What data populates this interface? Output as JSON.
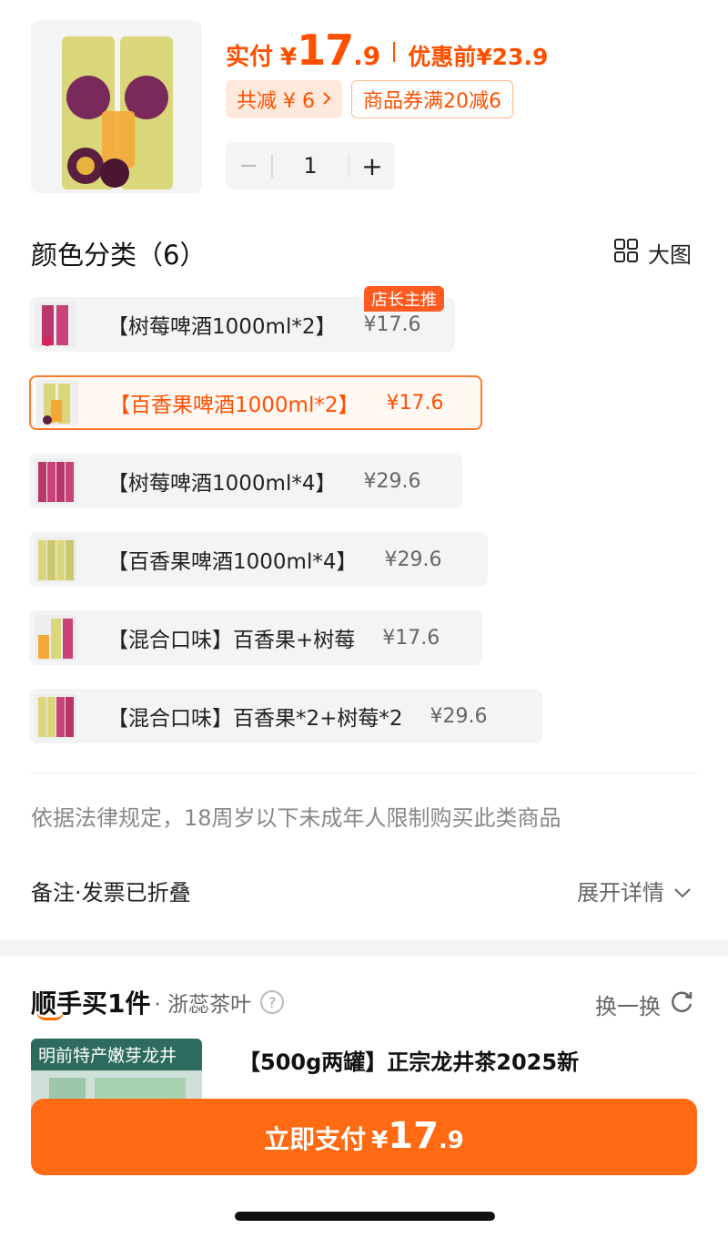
{
  "product": {
    "paid_label": "实付",
    "currency": "¥",
    "price_int": "17",
    "price_dec": ".9",
    "original_label": "优惠前",
    "original_price": "¥23.9",
    "discount_chip": "共减 ¥ 6",
    "coupon_chip": "商品券满20减6"
  },
  "stepper": {
    "minus": "−",
    "quantity": "1",
    "plus": "+"
  },
  "variants": {
    "title": "颜色分类（6）",
    "view_toggle": "大图",
    "recommend_tag": "店长主推",
    "options": [
      {
        "name": "【树莓啤酒1000ml*2】",
        "price": "¥17.6"
      },
      {
        "name": "【百香果啤酒1000ml*2】",
        "price": "¥17.6"
      },
      {
        "name": "【树莓啤酒1000ml*4】",
        "price": "¥29.6"
      },
      {
        "name": "【百香果啤酒1000ml*4】",
        "price": "¥29.6"
      },
      {
        "name": "【混合口味】百香果+树莓",
        "price": "¥17.6"
      },
      {
        "name": "【混合口味】百香果*2+树莓*2",
        "price": "¥29.6"
      }
    ]
  },
  "notice": "依据法律规定，18周岁以下未成年人限制购买此类商品",
  "remark": {
    "label": "备注·发票已折叠",
    "expand": "展开详情"
  },
  "add_on": {
    "title": "顺手买1件",
    "store": "· 浙蕊茶叶",
    "swap": "换一换",
    "item_banner": "明前特产嫩芽龙井",
    "item_name": "【500g两罐】正宗龙井茶2025新"
  },
  "pay": {
    "label": "立即支付",
    "currency": "¥",
    "int": "17",
    "dec": ".9"
  },
  "colors": {
    "accent": "#ff5000",
    "button": "#ff6a13",
    "chip_bg": "#ffe9dd"
  }
}
